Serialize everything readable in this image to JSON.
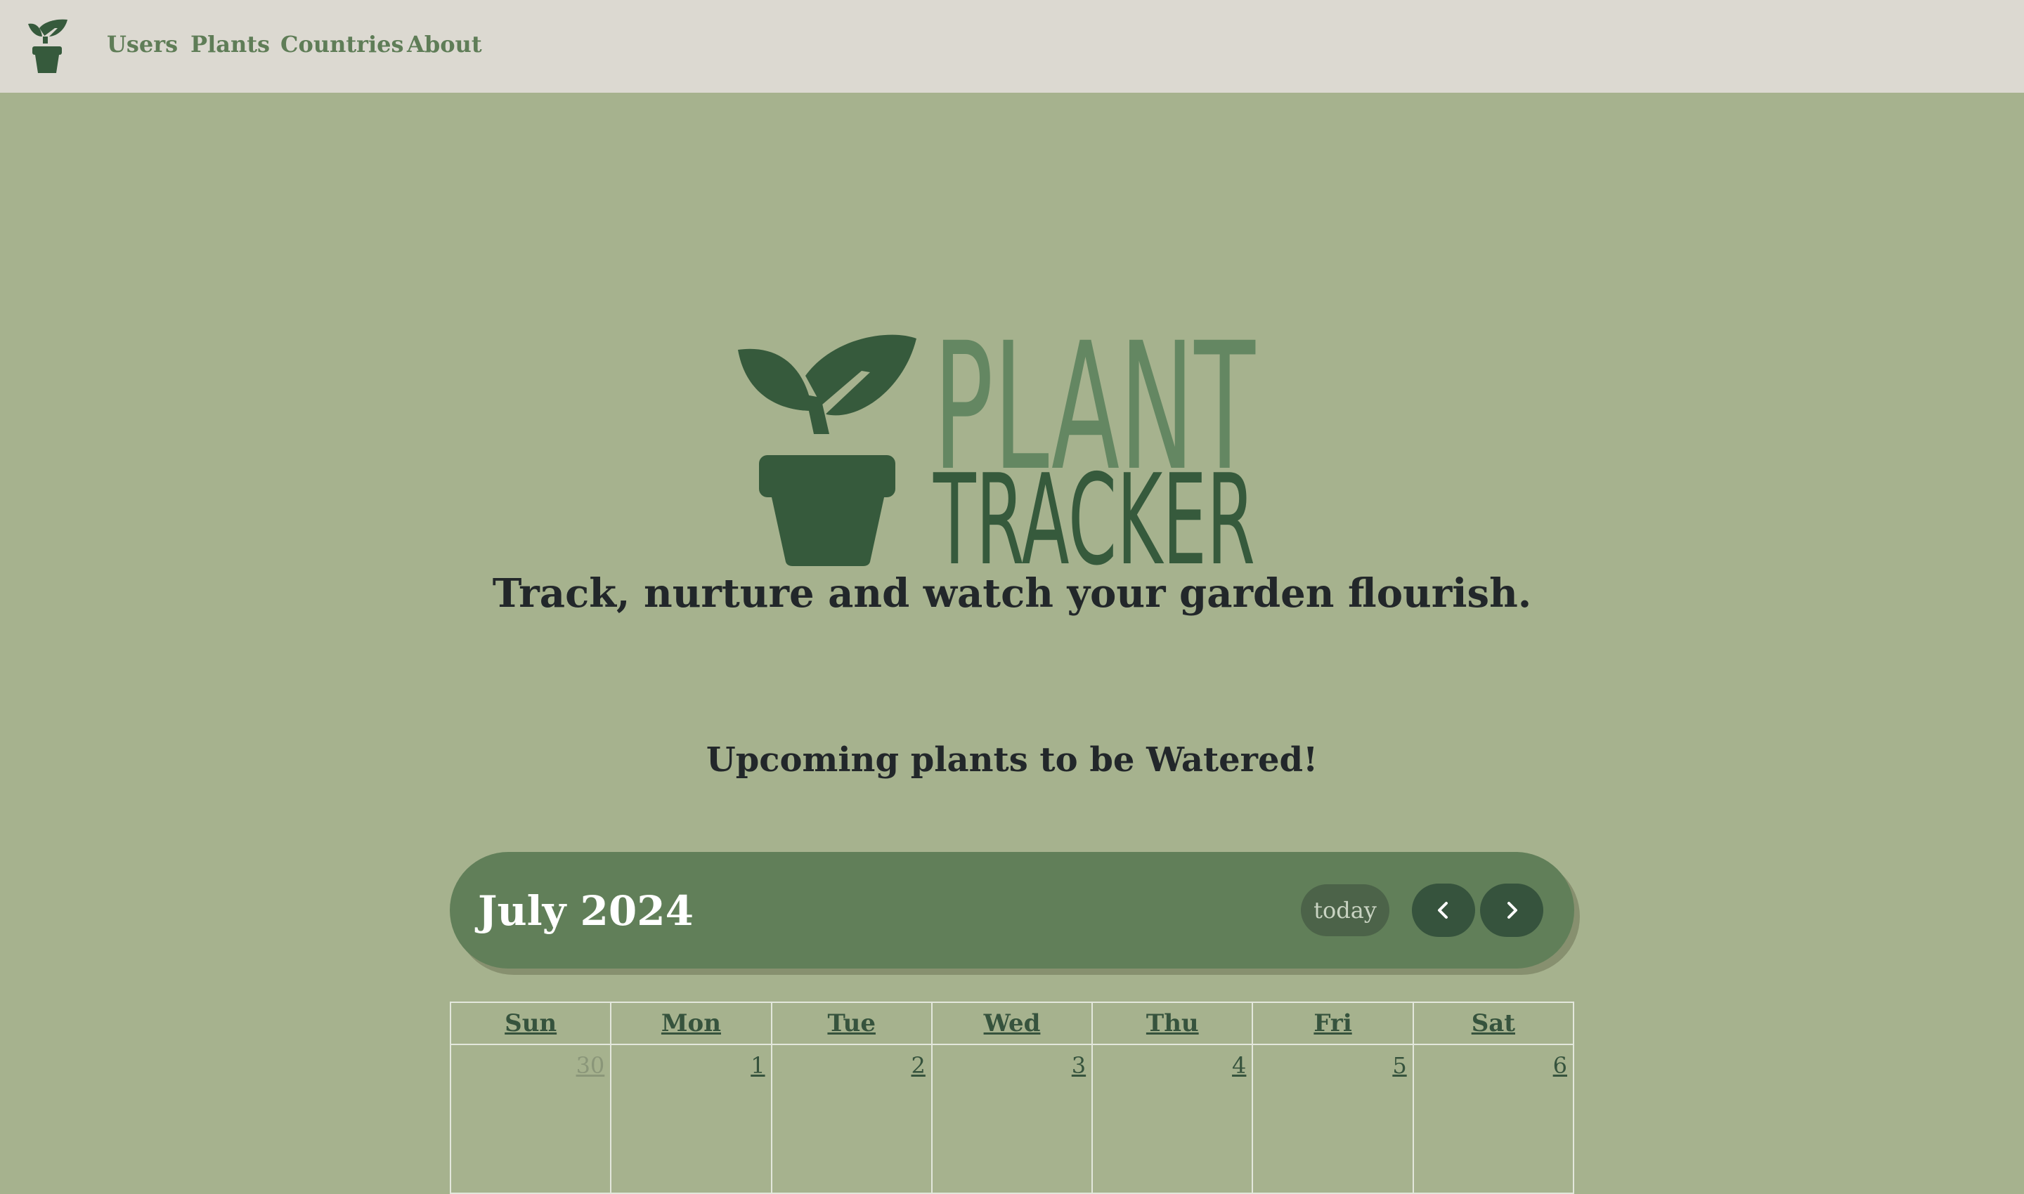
{
  "nav": {
    "links": [
      "Users",
      "Plants",
      "Countries",
      "About"
    ]
  },
  "logo": {
    "line1": "PLANT",
    "line2": "TRACKER"
  },
  "hero": {
    "tagline": "Track, nurture and watch your garden flourish."
  },
  "section": {
    "heading": "Upcoming plants to be Watered!"
  },
  "calendar": {
    "title": "July 2024",
    "today_label": "today",
    "prev_icon": "chevron-left-icon",
    "next_icon": "chevron-right-icon",
    "weekdays": [
      "Sun",
      "Mon",
      "Tue",
      "Wed",
      "Thu",
      "Fri",
      "Sat"
    ],
    "first_week": [
      "30",
      "1",
      "2",
      "3",
      "4",
      "5",
      "6"
    ]
  },
  "colors": {
    "background": "#a6b28e",
    "navbar": "#dcd9d1",
    "nav_link": "#5f7d57",
    "logo_dark": "#365a3c",
    "logo_light": "#648762",
    "calendar_header": "#617f59",
    "nav_button": "#36533d"
  }
}
